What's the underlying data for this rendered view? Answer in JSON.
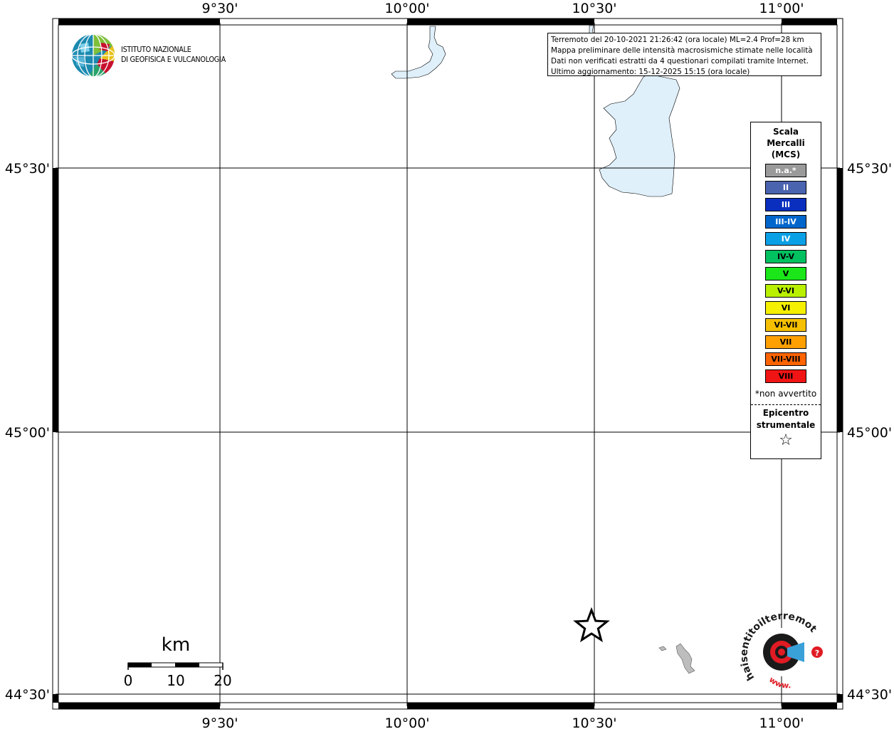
{
  "map": {
    "top_ticks": [
      "9°30'",
      "10°00'",
      "10°30'",
      "11°00'"
    ],
    "bottom_ticks": [
      "9°30'",
      "10°00'",
      "10°30'",
      "11°00'"
    ],
    "left_ticks": [
      "45°30'",
      "45°00'",
      "44°30'"
    ],
    "right_ticks": [
      "45°30'",
      "45°00'",
      "44°30'"
    ]
  },
  "logo": {
    "line1": "ISTITUTO NAZIONALE",
    "line2": "DI GEOFISICA E VULCANOLOGIA"
  },
  "info": {
    "line1": "Terremoto del 20-10-2021 21:26:42 (ora locale) ML=2.4 Prof=28 km",
    "line2": "Mappa preliminare delle intensità macrosismiche stimate nelle località",
    "line3": "Dati non verificati estratti da 4 questionari compilati tramite Internet.",
    "line4": "Ultimo aggiornamento: 15-12-2025 15:15 (ora locale)"
  },
  "legend": {
    "title_line1": "Scala",
    "title_line2": "Mercalli",
    "title_line3": "(MCS)",
    "items": [
      {
        "label": "n.a.*",
        "color": "#9a9a9a",
        "text_color": "#ffffff"
      },
      {
        "label": "II",
        "color": "#4a64b0",
        "text_color": "#ffffff"
      },
      {
        "label": "III",
        "color": "#0a2fbf",
        "text_color": "#ffffff"
      },
      {
        "label": "III-IV",
        "color": "#0066cc",
        "text_color": "#ffffff"
      },
      {
        "label": "IV",
        "color": "#0aa0e6",
        "text_color": "#ffffff"
      },
      {
        "label": "IV-V",
        "color": "#00c060",
        "text_color": "#000000"
      },
      {
        "label": "V",
        "color": "#1ae61a",
        "text_color": "#000000"
      },
      {
        "label": "V-VI",
        "color": "#b8f000",
        "text_color": "#000000"
      },
      {
        "label": "VI",
        "color": "#f5f000",
        "text_color": "#000000"
      },
      {
        "label": "VI-VII",
        "color": "#f5c000",
        "text_color": "#000000"
      },
      {
        "label": "VII",
        "color": "#ffa000",
        "text_color": "#000000"
      },
      {
        "label": "VII-VIII",
        "color": "#ff6400",
        "text_color": "#000000"
      },
      {
        "label": "VIII",
        "color": "#f01414",
        "text_color": "#000000"
      }
    ],
    "note": "*non avvertito",
    "epicenter_line1": "Epicentro",
    "epicenter_line2": "strumentale",
    "epicenter_symbol": "☆"
  },
  "scalebar": {
    "unit": "km",
    "labels": [
      "0",
      "10",
      "20"
    ]
  },
  "hst_logo": {
    "text": "haisentitoilterremoto.it",
    "www": "www."
  },
  "colors": {
    "lake": "#dff0fb",
    "grid": "#000000",
    "frame": "#000000"
  }
}
